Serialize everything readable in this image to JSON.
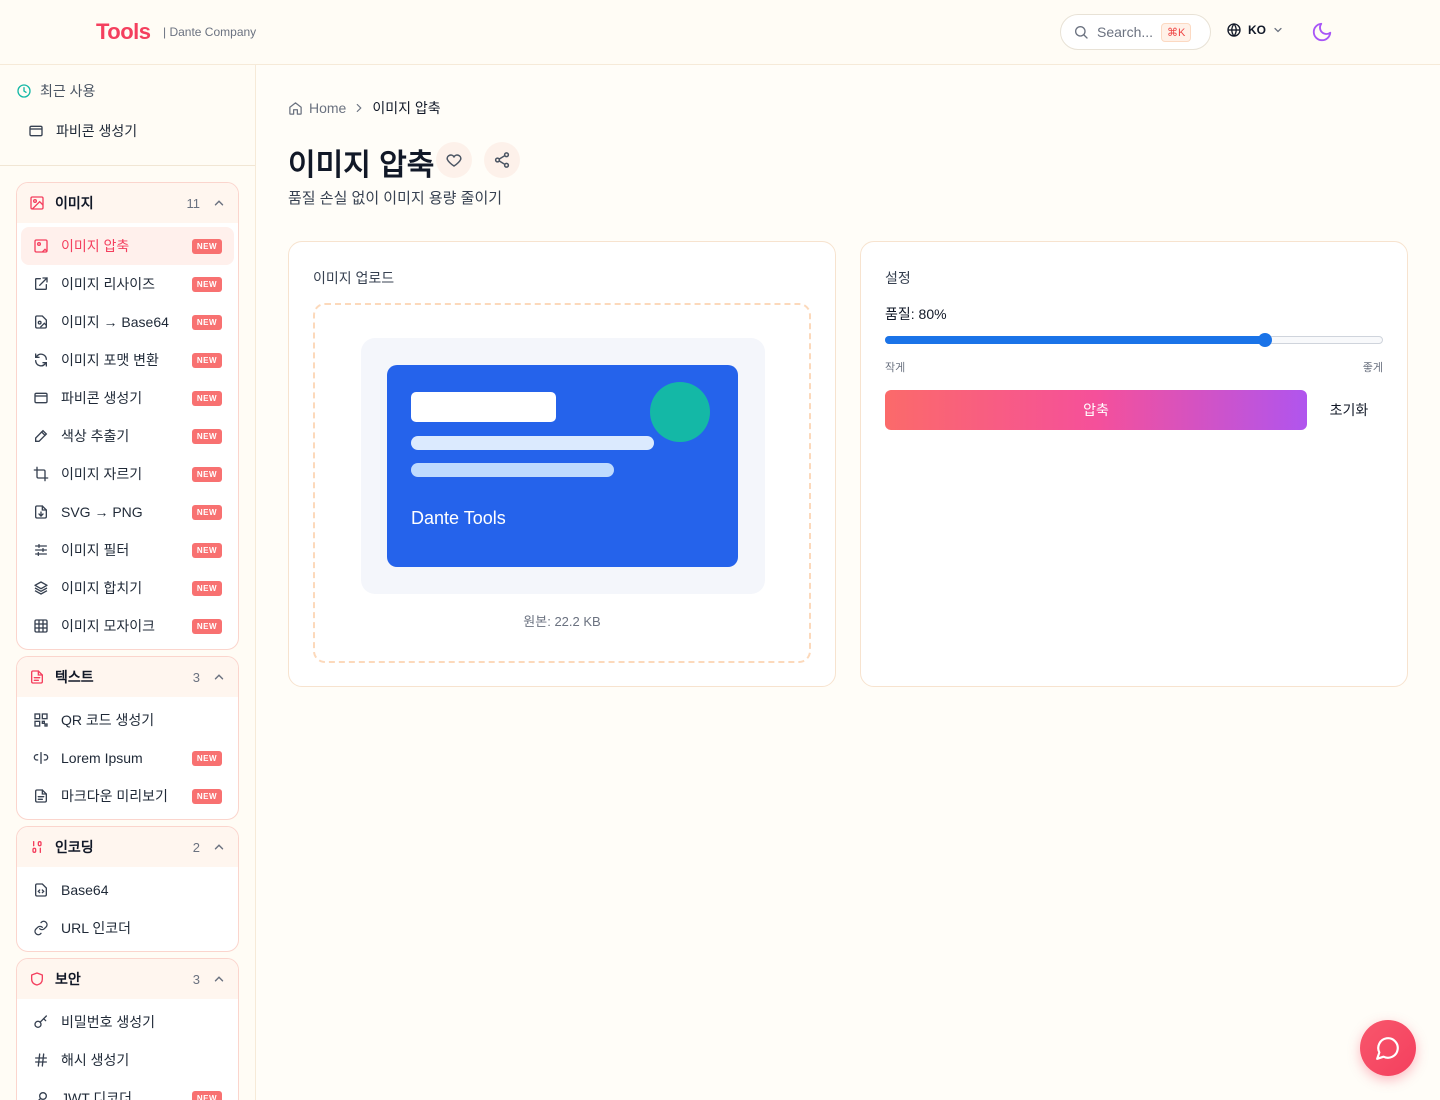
{
  "header": {
    "logo": "Tools",
    "company": "| Dante Company",
    "search_placeholder": "Search...",
    "search_shortcut": "⌘K",
    "language": "KO"
  },
  "sidebar": {
    "recent_title": "최근 사용",
    "recent_items": [
      "파비콘 생성기"
    ],
    "new_badge": "NEW",
    "groups": [
      {
        "name": "이미지",
        "count": "11",
        "items": [
          {
            "label": "이미지 압축",
            "badge": true,
            "active": true
          },
          {
            "label": "이미지 리사이즈",
            "badge": true
          },
          {
            "label": "이미지 → Base64",
            "badge": true
          },
          {
            "label": "이미지 포맷 변환",
            "badge": true
          },
          {
            "label": "파비콘 생성기",
            "badge": true
          },
          {
            "label": "색상 추출기",
            "badge": true
          },
          {
            "label": "이미지 자르기",
            "badge": true
          },
          {
            "label": "SVG → PNG",
            "badge": true
          },
          {
            "label": "이미지 필터",
            "badge": true
          },
          {
            "label": "이미지 합치기",
            "badge": true
          },
          {
            "label": "이미지 모자이크",
            "badge": true
          }
        ]
      },
      {
        "name": "텍스트",
        "count": "3",
        "items": [
          {
            "label": "QR 코드 생성기",
            "badge": false
          },
          {
            "label": "Lorem Ipsum",
            "badge": true
          },
          {
            "label": "마크다운 미리보기",
            "badge": true
          }
        ]
      },
      {
        "name": "인코딩",
        "count": "2",
        "items": [
          {
            "label": "Base64",
            "badge": false
          },
          {
            "label": "URL 인코더",
            "badge": false
          }
        ]
      },
      {
        "name": "보안",
        "count": "3",
        "items": [
          {
            "label": "비밀번호 생성기",
            "badge": false
          },
          {
            "label": "해시 생성기",
            "badge": false
          },
          {
            "label": "JWT 디코더",
            "badge": true
          }
        ]
      }
    ]
  },
  "breadcrumb": {
    "home": "Home",
    "current": "이미지 압축"
  },
  "page": {
    "title": "이미지 압축",
    "subtitle": "품질 손실 없이 이미지 용량 줄이기"
  },
  "upload": {
    "title": "이미지 업로드",
    "preview_caption": "Dante Tools",
    "original_size": "원본: 22.2 KB"
  },
  "settings": {
    "title": "설정",
    "quality_label": "품질: 80%",
    "quality_value": 0.77,
    "min_label": "작게",
    "max_label": "좋게",
    "compress_label": "압축",
    "reset_label": "초기화"
  },
  "colors": {
    "accent": "#f43f5e",
    "slider": "#1a73e8",
    "preview_blue": "#2563eb",
    "preview_circle": "#14b8a6"
  }
}
